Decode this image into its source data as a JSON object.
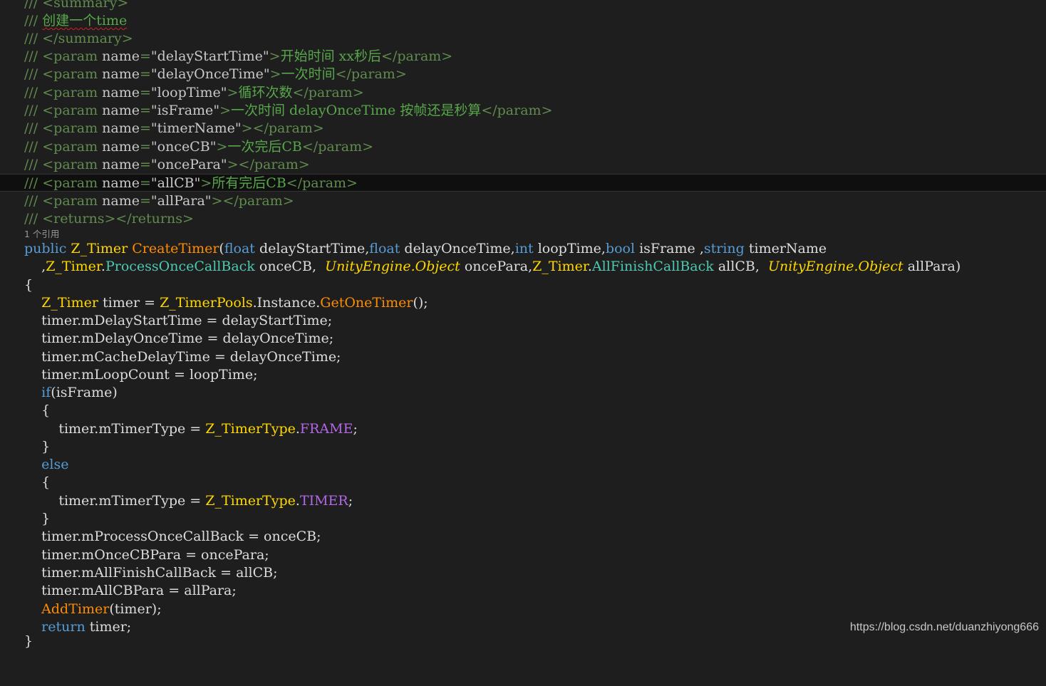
{
  "codelens": "1 个引用",
  "watermark": "https://blog.csdn.net/duanzhiyong666",
  "doc": {
    "summary_open": "<summary>",
    "summary_text": "创建一个time",
    "summary_close": "</summary>",
    "params": [
      {
        "name": "delayStartTime",
        "desc": "开始时间 xx秒后"
      },
      {
        "name": "delayOnceTime",
        "desc": "一次时间"
      },
      {
        "name": "loopTime",
        "desc": "循环次数"
      },
      {
        "name": "isFrame",
        "desc": "一次时间 delayOnceTime 按帧还是秒算"
      },
      {
        "name": "timerName",
        "desc": ""
      },
      {
        "name": "onceCB",
        "desc": "一次完后CB"
      },
      {
        "name": "oncePara",
        "desc": ""
      },
      {
        "name": "allCB",
        "desc": "所有完后CB"
      },
      {
        "name": "allPara",
        "desc": ""
      }
    ],
    "returns": "<returns></returns>"
  },
  "sig1": {
    "public": "public",
    "ret": "Z_Timer",
    "method": "CreateTimer",
    "t1": "float",
    "p1": "delayStartTime",
    "t2": "float",
    "p2": "delayOnceTime",
    "t3": "int",
    "p3": "loopTime",
    "t4": "bool",
    "p4": "isFrame ",
    "t5": "string",
    "p5": "timerName"
  },
  "sig2": {
    "z": "Z_Timer",
    "d1": "ProcessOnceCallBack",
    "p1": "onceCB",
    "ns1": "UnityEngine",
    "obj1": "Object",
    "p2": "oncePara",
    "d2": "AllFinishCallBack",
    "p3": "allCB",
    "ns2": "UnityEngine",
    "obj2": "Object",
    "p4": "allPara"
  },
  "body": {
    "decl_type": "Z_Timer",
    "decl_var": "timer",
    "pools": "Z_TimerPools",
    "instance": "Instance",
    "get": "GetOneTimer",
    "assign1": "timer.mDelayStartTime = delayStartTime;",
    "assign2": "timer.mDelayOnceTime = delayOnceTime;",
    "assign3": "timer.mCacheDelayTime = delayOnceTime;",
    "assign4": "timer.mLoopCount = loopTime;",
    "if_kw": "if",
    "if_cond": "(isFrame)",
    "type_lhs": "timer.mTimerType = ",
    "enum_type": "Z_TimerType",
    "frame": "FRAME",
    "else_kw": "else",
    "timer_val": "TIMER",
    "assign5": "timer.mProcessOnceCallBack = onceCB;",
    "assign6": "timer.mOnceCBPara = oncePara;",
    "assign7": "timer.mAllFinishCallBack = allCB;",
    "assign8": "timer.mAllCBPara = allPara;",
    "addtimer": "AddTimer",
    "addtimer_args": "(timer);",
    "return_kw": "return",
    "return_val": "timer;",
    "close_brace": "}"
  },
  "colors": {
    "background": "#1e1e1e",
    "comment": "#57a64a",
    "keyword": "#569cd6",
    "type": "#ffd700",
    "method": "#ff8c00",
    "delegate": "#4ec9b0",
    "enum_member": "#b267e6"
  }
}
